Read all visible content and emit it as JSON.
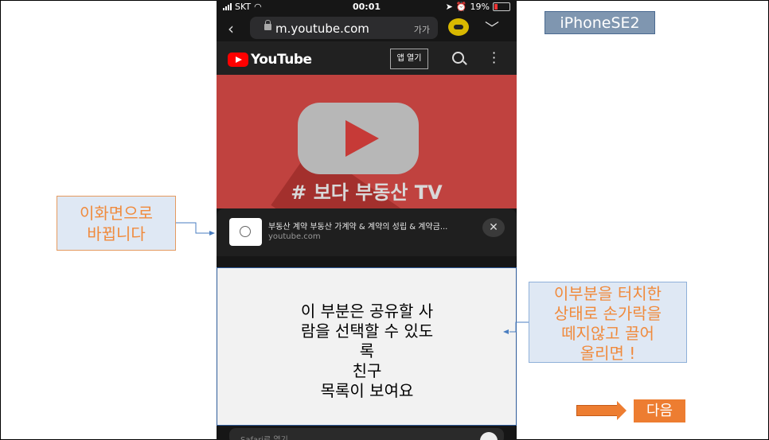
{
  "status_bar": {
    "carrier": "SKT",
    "time": "00:01",
    "battery": "19%",
    "battery_level": 0.19
  },
  "browser": {
    "url": "m.youtube.com",
    "text_size": "가가"
  },
  "youtube_header": {
    "logo_text": "YouTube",
    "open_app_button": "앱 열기"
  },
  "banner": {
    "text": "# 보다 부동산 TV"
  },
  "share_sheet": {
    "title": "부동산 계약 부동산 가계약 & 계약의 성립 & 계약금...",
    "url": "youtube.com",
    "close_label": "✕"
  },
  "overlay_box": {
    "lines": [
      "이 부분은 공유할 사",
      "람을 선택할 수 있도",
      "록",
      "친구",
      "목록이 보여요"
    ]
  },
  "bottom_action": {
    "label": "Safari로 열기"
  },
  "labels": {
    "device": "iPhoneSE2",
    "left_callout": [
      "이화면으로",
      "바뀝니다"
    ],
    "right_callout": [
      "이부분을 터치한",
      "상태로 손가락을",
      "떼지않고 끌어",
      "올리면 !"
    ],
    "next_button": "다음"
  },
  "colors": {
    "accent_orange": "#ed7d31",
    "youtube_red": "#ff0000",
    "banner_red": "#c0423f"
  }
}
